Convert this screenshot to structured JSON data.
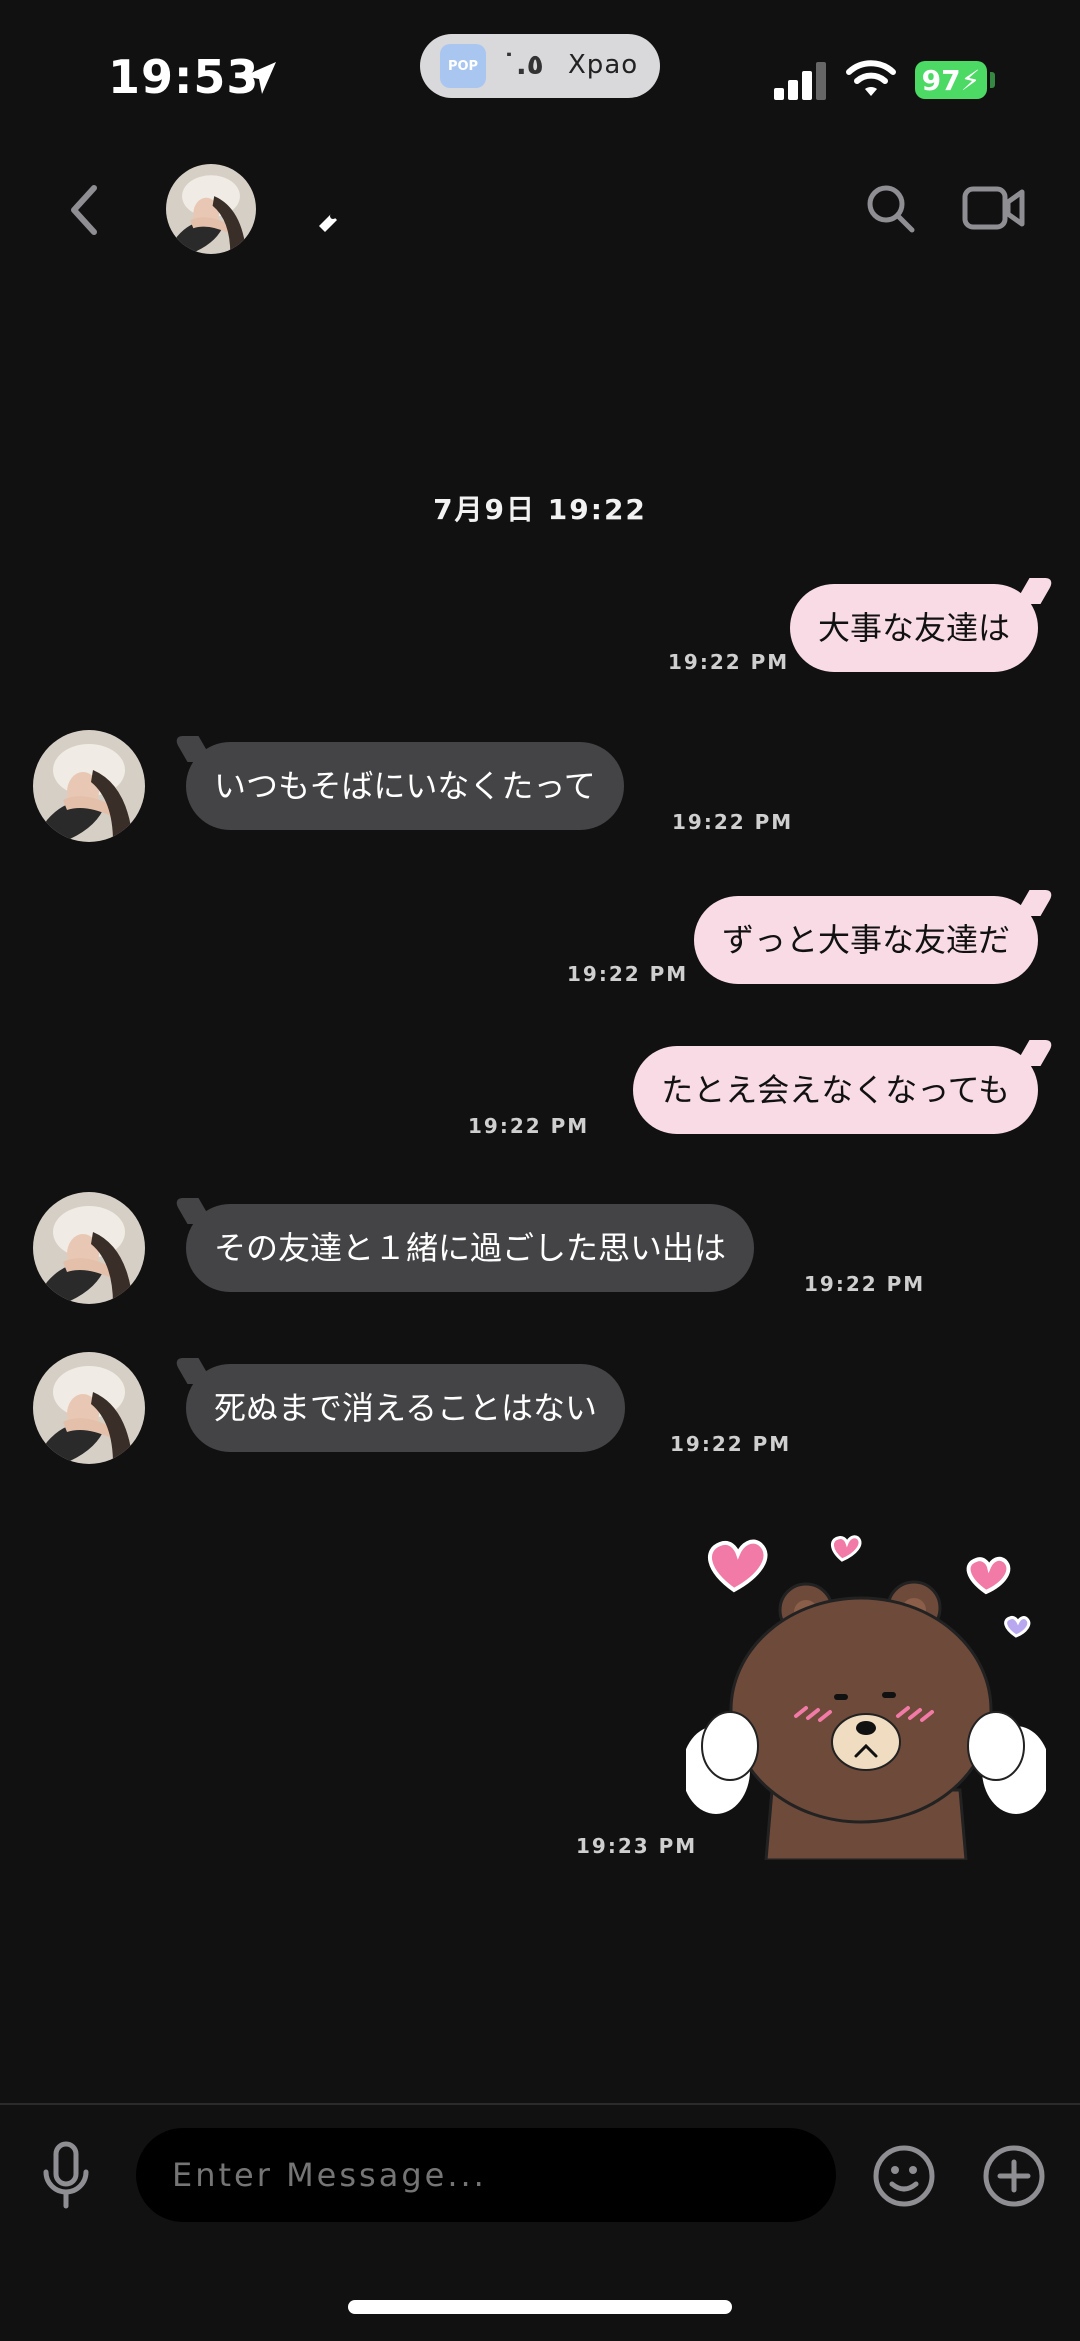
{
  "status_bar": {
    "time": "19:53",
    "pill_app_icon_text": "POP",
    "pill_text_1": "˙.٥",
    "pill_text_2": "Xpao",
    "battery": "97"
  },
  "header": {
    "back_icon": "chevron-left-icon",
    "search_icon": "search-icon",
    "video_icon": "video-call-icon"
  },
  "conversation": {
    "date": "7月9日 19:22",
    "messages": [
      {
        "side": "out",
        "text": "大事な友達は",
        "time": "19:22 PM"
      },
      {
        "side": "in",
        "text": "いつもそばにいなくたって",
        "time": "19:22 PM"
      },
      {
        "side": "out",
        "text": "ずっと大事な友達だ",
        "time": "19:22 PM"
      },
      {
        "side": "out",
        "text": "たとえ会えなくなっても",
        "time": "19:22 PM"
      },
      {
        "side": "in",
        "text": "その友達と１緒に過ごした思い出は",
        "time": "19:22 PM"
      },
      {
        "side": "in",
        "text": "死ぬまで消えることはない",
        "time": "19:22 PM"
      },
      {
        "side": "out",
        "type": "sticker",
        "sticker": "brown-bear-hearts-sticker",
        "time": "19:23 PM"
      }
    ]
  },
  "composer": {
    "placeholder": "Enter Message...",
    "mic_icon": "microphone-icon",
    "emoji_icon": "emoji-icon",
    "plus_icon": "plus-circle-icon"
  },
  "colors": {
    "background": "#111111",
    "outgoing_bubble": "#f8dbe4",
    "incoming_bubble": "#444446",
    "battery": "#4cd964"
  }
}
